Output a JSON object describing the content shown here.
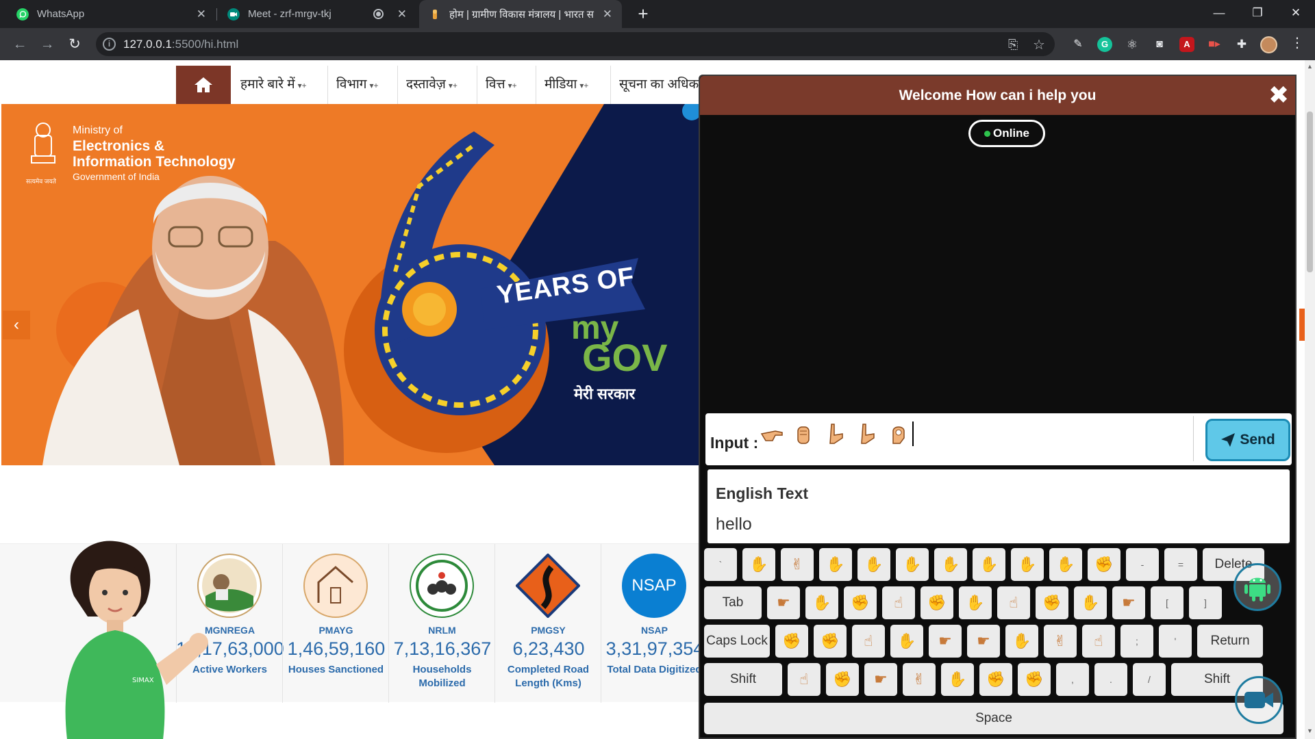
{
  "browser": {
    "tabs": [
      {
        "title": "WhatsApp",
        "close": "✕",
        "favicon": "whatsapp-icon",
        "color": "#25d366"
      },
      {
        "title": "Meet - zrf-mrgv-tkj",
        "close": "✕",
        "favicon": "meet-icon",
        "color": "#00897b"
      },
      {
        "title": "होम | ग्रामीण विकास मंत्रालय | भारत स",
        "close": "✕",
        "favicon": "emblem-icon",
        "color": "#e8a13a"
      }
    ],
    "new_tab": "+",
    "window_controls": {
      "minimize": "—",
      "restore": "❐",
      "close": "✕"
    },
    "url": {
      "host": "127.0.0.1",
      "path": ":5500/hi.html"
    },
    "nav": {
      "back": "←",
      "forward": "→",
      "reload": "↻"
    }
  },
  "menu": {
    "items": [
      {
        "label": "हमारे बारे में",
        "caret": "▾+"
      },
      {
        "label": "विभाग",
        "caret": "▾+"
      },
      {
        "label": "दस्तावेज़",
        "caret": "▾+"
      },
      {
        "label": "वित्त",
        "caret": "▾+"
      },
      {
        "label": "मीडिया",
        "caret": "▾+"
      },
      {
        "label": "सूचना का अधिकार",
        "caret": ""
      }
    ]
  },
  "hero": {
    "ministry": {
      "line1": "Ministry of",
      "line2": "Electronics &",
      "line3": "Information Technology",
      "line4": "Government of India",
      "motto": "सत्यमेव जयते"
    },
    "banner_years": "YEARS OF",
    "banner_my": "my",
    "banner_gov": "GOV",
    "banner_tagline": "मेरी सरकार",
    "prev_arrow": "‹",
    "colors": {
      "orange": "#ee7a26",
      "navy": "#0c1a4a",
      "ribbon": "#1f3a8a",
      "yellow": "#f6d02a"
    }
  },
  "stats": [
    {
      "name": "MGNREGA",
      "value": "13,17,63,000",
      "desc": "Active Workers"
    },
    {
      "name": "PMAYG",
      "value": "1,46,59,160",
      "desc": "Houses Sanctioned"
    },
    {
      "name": "NRLM",
      "value": "7,13,16,367",
      "desc": "Households Mobilized"
    },
    {
      "name": "PMGSY",
      "value": "6,23,430",
      "desc": "Completed Road Length (Kms)"
    },
    {
      "name": "NSAP",
      "value": "3,31,97,354",
      "desc": "Total Data Digitized",
      "logo_text": "NSAP"
    }
  ],
  "avatar_badge": "SIMAX",
  "chat": {
    "title": "Welcome How can i help you",
    "close": "✖",
    "status": "Online",
    "input_label": "Input :",
    "input_glyphs": [
      "h",
      "e",
      "l",
      "l",
      "o"
    ],
    "send_label": "Send",
    "english_heading": "English Text",
    "english_value": "hello"
  },
  "keyboard": {
    "row1": [
      "`",
      "1",
      "2",
      "3",
      "4",
      "5",
      "6",
      "7",
      "8",
      "9",
      "0",
      "-",
      "=",
      "Delete"
    ],
    "row2": [
      "Tab",
      "q",
      "w",
      "e",
      "r",
      "t",
      "y",
      "u",
      "i",
      "o",
      "p",
      "[",
      "]"
    ],
    "row3": [
      "Caps Lock",
      "a",
      "s",
      "d",
      "f",
      "g",
      "h",
      "j",
      "k",
      "l",
      ";",
      "'",
      "Return"
    ],
    "row4": [
      "Shift",
      "z",
      "x",
      "c",
      "v",
      "b",
      "n",
      "m",
      ",",
      ".",
      "/",
      "Shift"
    ],
    "space": "Space"
  },
  "colors": {
    "chat_header": "#7a3a2b",
    "send": "#5fc8e8",
    "brand_blue": "#2c6bab",
    "home_btn": "#7c3627"
  }
}
